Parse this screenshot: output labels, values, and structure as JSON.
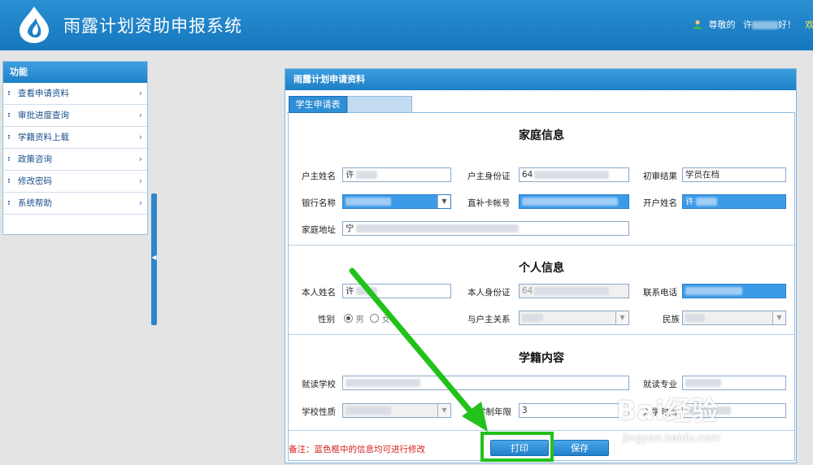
{
  "app": {
    "title": "雨露计划资助申报系统"
  },
  "header": {
    "greeting_prefix": "尊敬的",
    "greeting_name": "许",
    "greeting_suffix": "好！",
    "welcome_tail": "欢"
  },
  "sidebar": {
    "title": "功能",
    "items": [
      {
        "label": "查看申请资料"
      },
      {
        "label": "审批进度查询"
      },
      {
        "label": "学籍资料上载"
      },
      {
        "label": "政策咨询"
      },
      {
        "label": "修改密码"
      },
      {
        "label": "系统帮助"
      }
    ]
  },
  "panel": {
    "title": "雨露计划申请资料",
    "tabs": [
      {
        "label": "学生申请表"
      },
      {
        "label": ""
      }
    ],
    "family": {
      "title": "家庭信息",
      "head_name_label": "户主姓名",
      "head_name_value": "许",
      "head_id_label": "户主身份证",
      "head_id_value": "64",
      "review_label": "初审结果",
      "review_value": "学员在档",
      "bank_label": "银行名称",
      "bank_value": "",
      "card_label": "直补卡帐号",
      "card_value": "",
      "holder_label": "开户姓名",
      "holder_value": "许",
      "address_label": "家庭地址",
      "address_value": "宁"
    },
    "personal": {
      "title": "个人信息",
      "name_label": "本人姓名",
      "name_value": "许",
      "id_label": "本人身份证",
      "id_value": "64",
      "phone_label": "联系电话",
      "phone_value": "",
      "gender_label": "性别",
      "gender_male": "男",
      "gender_female": "女",
      "relation_label": "与户主关系",
      "relation_value": "",
      "ethnic_label": "民族",
      "ethnic_value": ""
    },
    "school": {
      "title": "学籍内容",
      "school_label": "就读学校",
      "school_value": "",
      "major_label": "就读专业",
      "major_value": "",
      "type_label": "学校性质",
      "type_value": "",
      "years_label": "学制年限",
      "years_value": "3",
      "enroll_label": "入学时间",
      "enroll_value": ""
    },
    "note": "备注：蓝色框中的信息均可进行修改",
    "print_label": "打印",
    "save_label": "保存"
  },
  "watermark": {
    "logo": "Bai经验",
    "url": "jingyan.baidu.com"
  },
  "colors": {
    "accent": "#1e7fc6",
    "editable_field": "#3c9be8",
    "annotation": "#22c21a",
    "note": "#d42020"
  }
}
